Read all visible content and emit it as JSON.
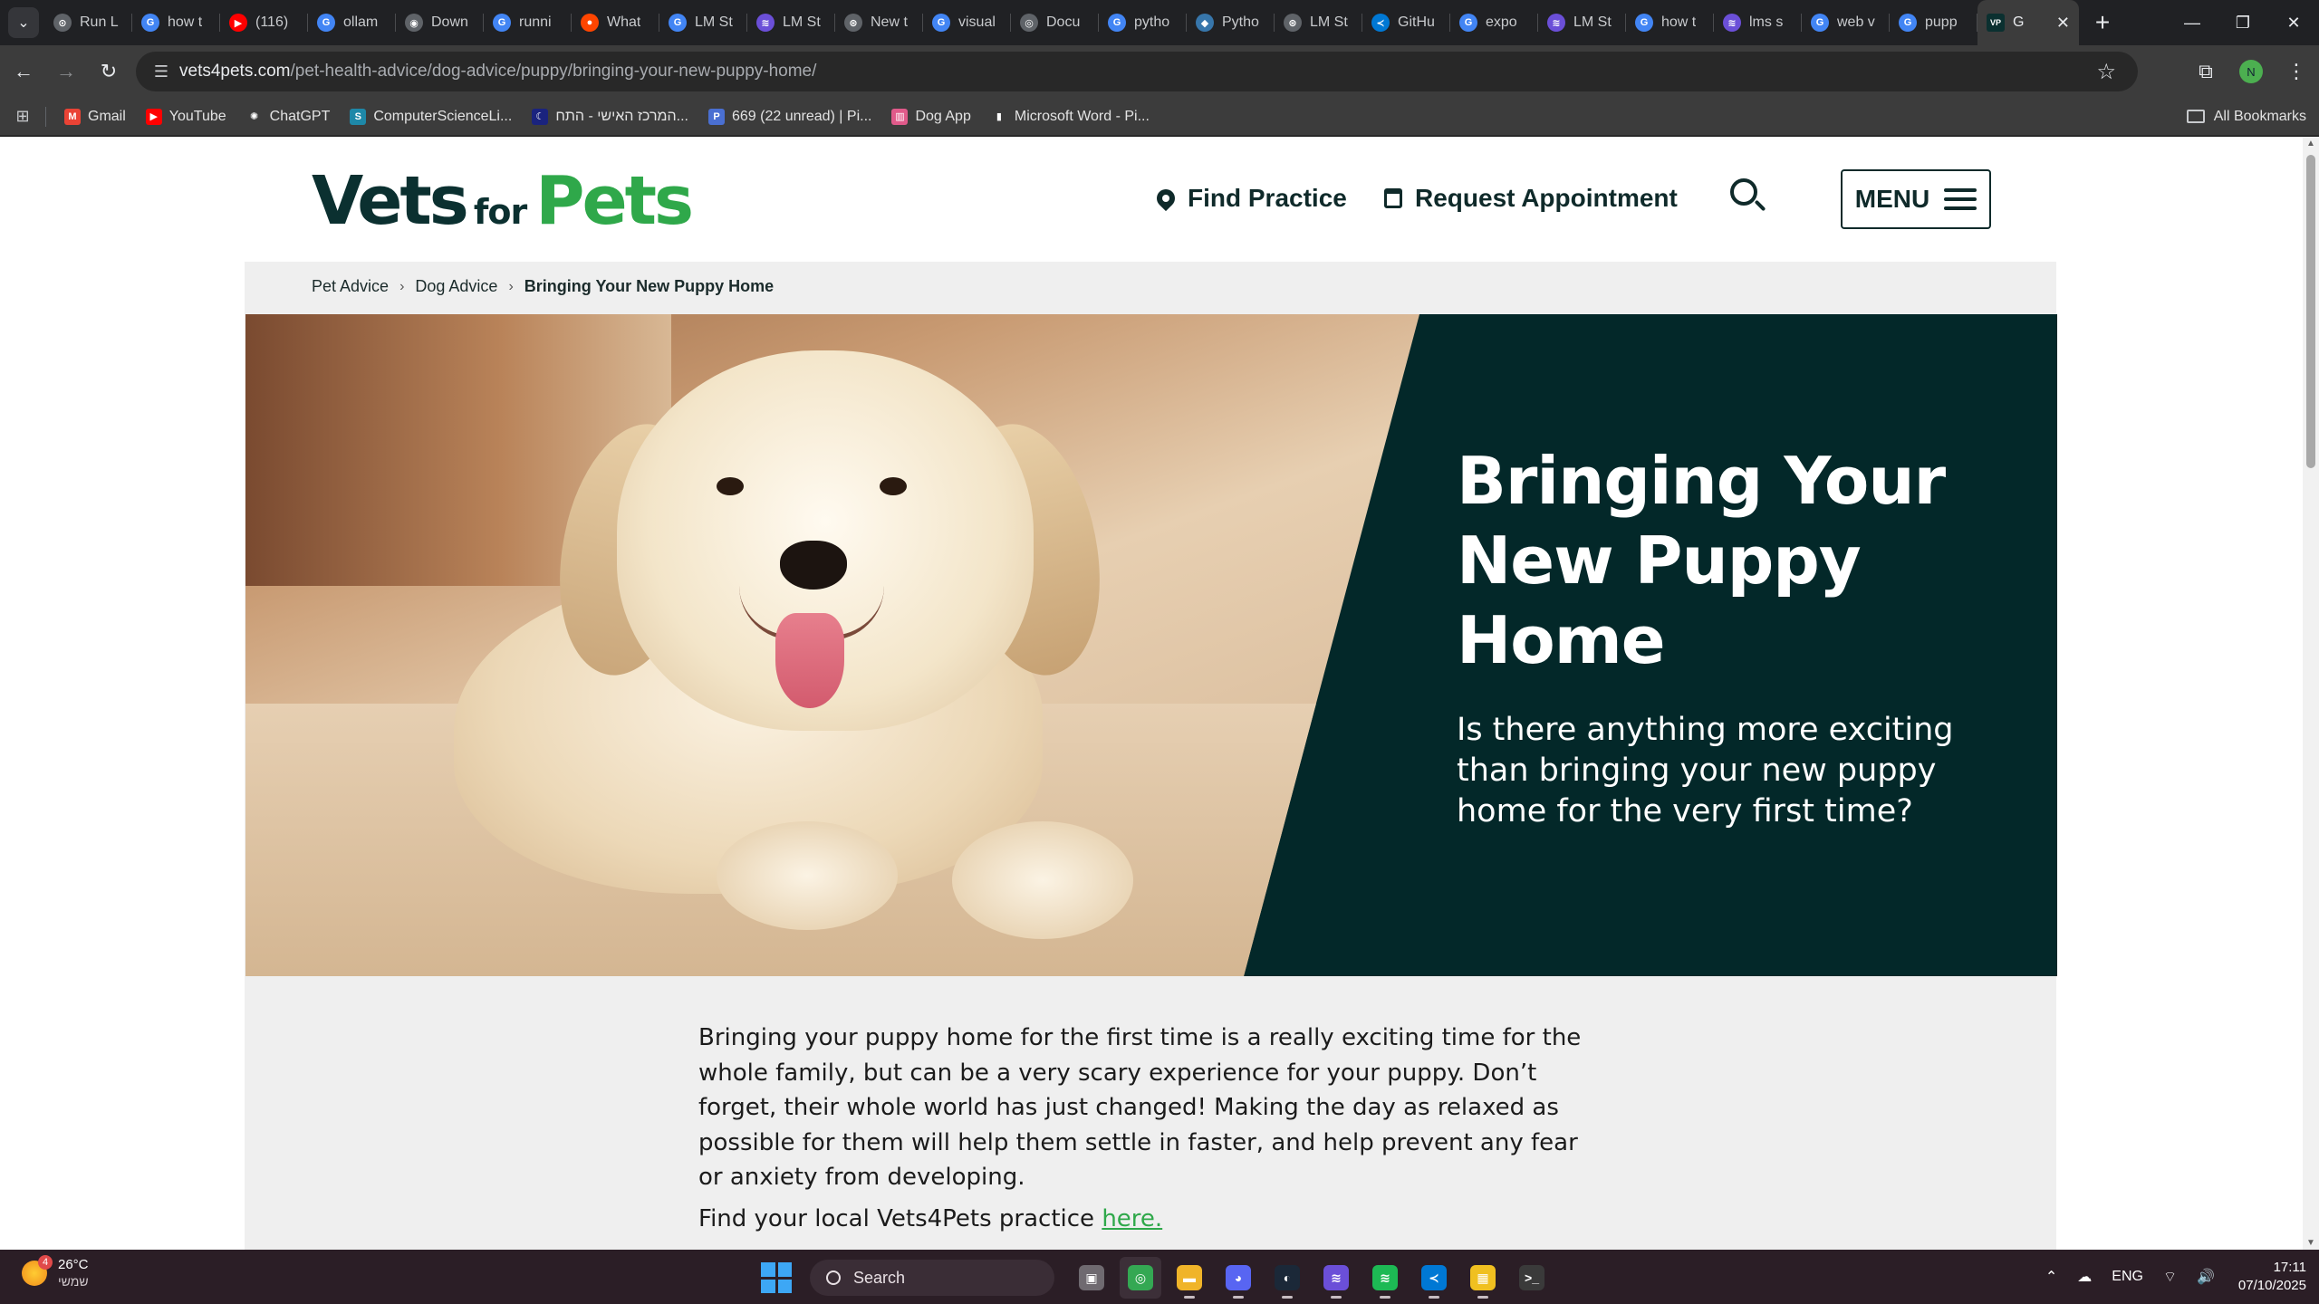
{
  "browser": {
    "tabs": [
      {
        "label": "Run L",
        "fav_color": "#5f6368",
        "glyph": "⊙"
      },
      {
        "label": "how t",
        "fav_color": "#4285f4",
        "glyph": "G"
      },
      {
        "label": "(116)",
        "fav_color": "#ff0000",
        "glyph": "▶"
      },
      {
        "label": "ollam",
        "fav_color": "#4285f4",
        "glyph": "G"
      },
      {
        "label": "Down",
        "fav_color": "#5f6368",
        "glyph": "◉"
      },
      {
        "label": "runni",
        "fav_color": "#4285f4",
        "glyph": "G"
      },
      {
        "label": "What",
        "fav_color": "#ff4500",
        "glyph": "●"
      },
      {
        "label": "LM St",
        "fav_color": "#4285f4",
        "glyph": "G"
      },
      {
        "label": "LM St",
        "fav_color": "#6b4fd8",
        "glyph": "≋"
      },
      {
        "label": "New t",
        "fav_color": "#5f6368",
        "glyph": "⊛"
      },
      {
        "label": "visual",
        "fav_color": "#4285f4",
        "glyph": "G"
      },
      {
        "label": "Docu",
        "fav_color": "#5f6368",
        "glyph": "◎"
      },
      {
        "label": "pytho",
        "fav_color": "#4285f4",
        "glyph": "G"
      },
      {
        "label": "Pytho",
        "fav_color": "#3776ab",
        "glyph": "◆"
      },
      {
        "label": "LM St",
        "fav_color": "#5f6368",
        "glyph": "⊛"
      },
      {
        "label": "GitHu",
        "fav_color": "#0078d4",
        "glyph": "≺"
      },
      {
        "label": "expo",
        "fav_color": "#4285f4",
        "glyph": "G"
      },
      {
        "label": "LM St",
        "fav_color": "#6b4fd8",
        "glyph": "≋"
      },
      {
        "label": "how t",
        "fav_color": "#4285f4",
        "glyph": "G"
      },
      {
        "label": "lms s",
        "fav_color": "#6b4fd8",
        "glyph": "≋"
      },
      {
        "label": "web v",
        "fav_color": "#4285f4",
        "glyph": "G"
      },
      {
        "label": "pupp",
        "fav_color": "#4285f4",
        "glyph": "G"
      }
    ],
    "active_tab": {
      "label": "G",
      "fav_color": "#0b3030",
      "glyph": "VP"
    },
    "url_host": "vets4pets.com",
    "url_path": "/pet-health-advice/dog-advice/puppy/bringing-your-new-puppy-home/",
    "profile_initial": "N",
    "bookmarks": [
      {
        "label": "Gmail",
        "color": "#ea4335",
        "glyph": "M"
      },
      {
        "label": "YouTube",
        "color": "#ff0000",
        "glyph": "▶"
      },
      {
        "label": "ChatGPT",
        "color": "#3c3c3c",
        "glyph": "✺"
      },
      {
        "label": "ComputerScienceLi...",
        "color": "#1e88a8",
        "glyph": "S"
      },
      {
        "label": "המרכז האישי - התח...",
        "color": "#1a237e",
        "glyph": "☾"
      },
      {
        "label": "669 (22 unread) | Pi...",
        "color": "#4a6fd1",
        "glyph": "P"
      },
      {
        "label": "Dog App",
        "color": "#e05a8a",
        "glyph": "▥"
      },
      {
        "label": "Microsoft Word - Pi...",
        "color": "#3c3c3c",
        "glyph": "▮"
      }
    ],
    "all_bookmarks_label": "All Bookmarks"
  },
  "site": {
    "logo": {
      "part1": "Vets",
      "part2": "for",
      "part3": "Pets"
    },
    "nav": {
      "find_practice": "Find Practice",
      "request_appointment": "Request Appointment",
      "menu": "MENU"
    },
    "breadcrumb": [
      "Pet Advice",
      "Dog Advice",
      "Bringing Your New Puppy Home"
    ],
    "hero": {
      "title": "Bringing Your New Puppy Home",
      "subtitle": "Is there anything more exciting than bringing your new puppy home for the very first time?"
    },
    "body": {
      "paragraph": "Bringing your puppy home for the first time is a really exciting time for the whole family, but can be a very scary experience for your puppy. Don’t forget, their whole world has just changed! Making the day as relaxed as possible for them will help them settle in faster, and help prevent any fear or anxiety from developing.",
      "find_prefix": "Find your local Vets4Pets practice ",
      "find_link": "here."
    },
    "colors": {
      "brand_dark": "#032829",
      "brand_green": "#2fa84a"
    }
  },
  "taskbar": {
    "weather_temp": "26°C",
    "weather_cond": "שמשי",
    "weather_badge": "4",
    "search_label": "Search",
    "apps": [
      {
        "name": "task-view",
        "color": "#6f6a70",
        "glyph": "▣"
      },
      {
        "name": "chrome",
        "color": "#34a853",
        "glyph": "◎"
      },
      {
        "name": "file-explorer",
        "color": "#f0b429",
        "glyph": "▬"
      },
      {
        "name": "discord",
        "color": "#5865f2",
        "glyph": "◕"
      },
      {
        "name": "steam",
        "color": "#1b2838",
        "glyph": "◐"
      },
      {
        "name": "lm-studio",
        "color": "#6b4fd8",
        "glyph": "≋"
      },
      {
        "name": "spotify",
        "color": "#1db954",
        "glyph": "≋"
      },
      {
        "name": "vscode",
        "color": "#0078d4",
        "glyph": "≺"
      },
      {
        "name": "store",
        "color": "#f0c020",
        "glyph": "▦"
      },
      {
        "name": "terminal",
        "color": "#3a3a3a",
        "glyph": ">_"
      }
    ],
    "language": "ENG",
    "time": "17:11",
    "date": "07/10/2025"
  }
}
